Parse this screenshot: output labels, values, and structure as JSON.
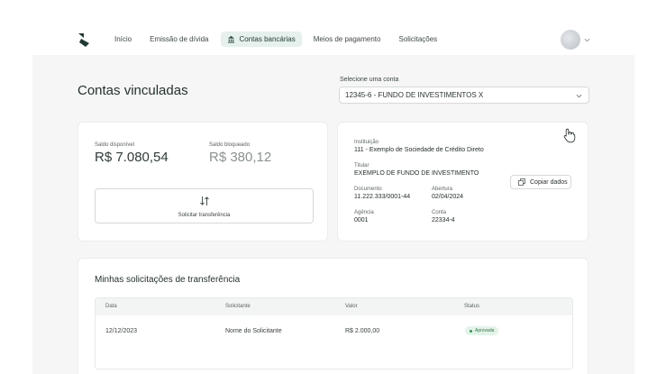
{
  "nav": {
    "items": [
      {
        "label": "Início"
      },
      {
        "label": "Emissão de dívida"
      },
      {
        "label": "Contas bancárias",
        "active": true
      },
      {
        "label": "Meios de pagamento"
      },
      {
        "label": "Solicitações"
      }
    ]
  },
  "page": {
    "title": "Contas vinculadas",
    "select_label": "Selecione uma conta",
    "select_value": "12345-6 - FUNDO DE INVESTIMENTOS X"
  },
  "balance": {
    "available_label": "Saldo disponível",
    "available_value": "R$ 7.080,54",
    "blocked_label": "Saldo bloqueado",
    "blocked_value": "R$ 380,12",
    "transfer_button": "Solicitar transferência"
  },
  "account": {
    "institution_label": "Instituição",
    "institution_value": "111 - Exemplo de Sociedade de Crédito Direto",
    "holder_label": "Titular",
    "holder_value": "EXEMPLO DE FUNDO DE INVESTIMENTO",
    "document_label": "Documento",
    "document_value": "11.222.333/0001-44",
    "opening_label": "Abertura",
    "opening_value": "02/04/2024",
    "agency_label": "Agência",
    "agency_value": "0001",
    "account_label": "Conta",
    "account_value": "22334-4",
    "copy_button": "Copiar dados"
  },
  "transfers": {
    "title": "Minhas solicitações de transferência",
    "columns": [
      "Data",
      "Solicitante",
      "Valor",
      "Status"
    ],
    "rows": [
      {
        "date": "12/12/2023",
        "requester": "Nome do Solicitante",
        "value": "R$ 2.000,00",
        "status": "Aprovada"
      }
    ]
  },
  "colors": {
    "brand": "#1f3b34",
    "active_nav_bg": "#e6f0ec",
    "status_ok": "#2f9a55"
  }
}
